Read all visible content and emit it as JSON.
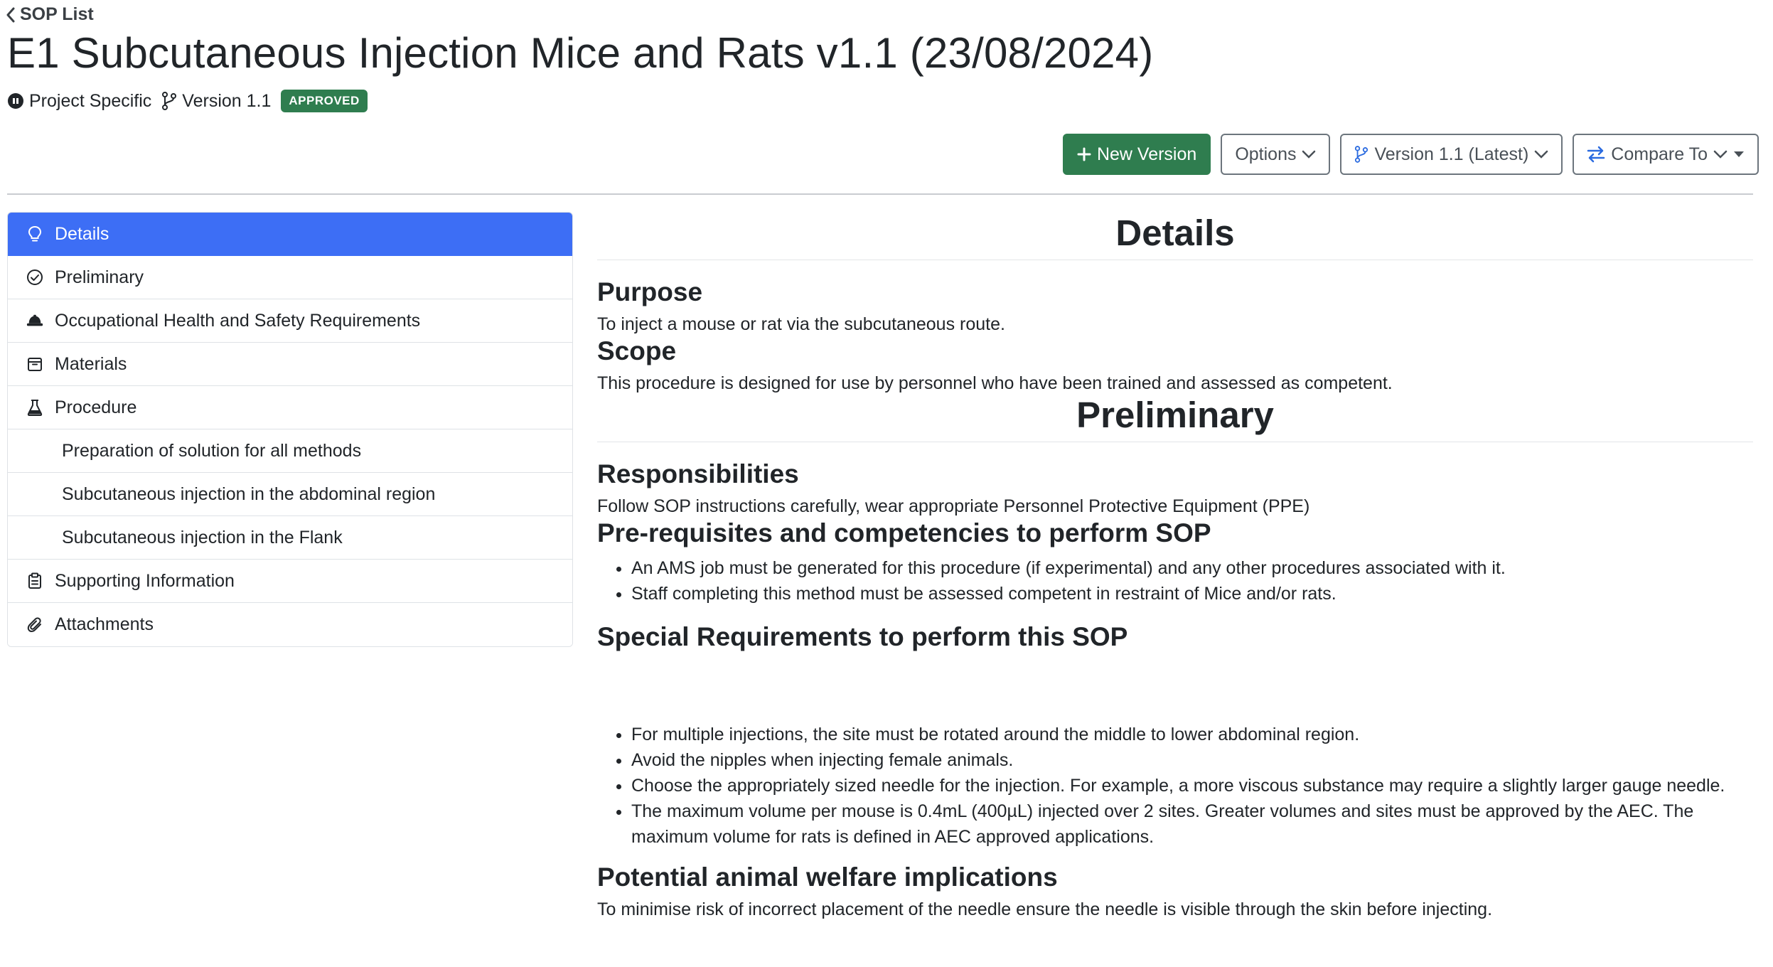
{
  "header": {
    "back_label": "SOP List",
    "title": "E1 Subcutaneous Injection Mice and Rats v1.1 (23/08/2024)",
    "category": "Project Specific",
    "version": "Version 1.1",
    "status": "APPROVED"
  },
  "toolbar": {
    "new_version": "New Version",
    "options": "Options",
    "version_select": "Version 1.1 (Latest)",
    "compare_to": "Compare To"
  },
  "sidebar": {
    "items": [
      {
        "label": "Details",
        "icon": "lightbulb-icon"
      },
      {
        "label": "Preliminary",
        "icon": "check-circle-icon"
      },
      {
        "label": "Occupational Health and Safety Requirements",
        "icon": "hard-hat-icon"
      },
      {
        "label": "Materials",
        "icon": "box-icon"
      },
      {
        "label": "Procedure",
        "icon": "flask-icon"
      },
      {
        "label": "Preparation of solution for all methods"
      },
      {
        "label": "Subcutaneous injection in the abdominal region"
      },
      {
        "label": "Subcutaneous injection in the Flank"
      },
      {
        "label": "Supporting Information",
        "icon": "clipboard-icon"
      },
      {
        "label": "Attachments",
        "icon": "paperclip-icon"
      }
    ]
  },
  "content": {
    "details_title": "Details",
    "purpose_title": "Purpose",
    "purpose_text": "To inject a mouse or rat via the subcutaneous route.",
    "scope_title": "Scope",
    "scope_text": "This procedure is designed for use by personnel who have been trained and assessed as competent.",
    "preliminary_title": "Preliminary",
    "responsibilities_title": "Responsibilities",
    "responsibilities_text": "Follow SOP instructions carefully, wear appropriate Personnel Protective Equipment (PPE)",
    "prereq_title": "Pre-requisites and competencies to perform SOP",
    "prereq_items": [
      "An AMS job must be generated for this procedure (if experimental) and any other procedures associated with it.",
      "Staff completing this method must be assessed competent in restraint of Mice and/or rats."
    ],
    "special_title": "Special Requirements to perform this SOP",
    "special_items": [
      "For multiple injections, the site must be rotated around the middle to lower abdominal region.",
      "Avoid the nipples when injecting female animals.",
      "Choose the appropriately sized needle for the injection. For example, a more viscous substance may require a slightly larger gauge needle.",
      "The maximum volume per mouse is 0.4mL (400µL) injected over 2 sites. Greater volumes and sites must be approved by the AEC. The maximum volume for rats is defined in AEC approved applications."
    ],
    "welfare_title": "Potential animal welfare implications",
    "welfare_text": "To minimise risk of incorrect placement of the needle ensure the needle is visible through the skin before injecting."
  },
  "colors": {
    "primary": "#3d6ef5",
    "success": "#2f7d4f",
    "compare_icon": "#2b6be0",
    "border": "#dee2e6"
  }
}
